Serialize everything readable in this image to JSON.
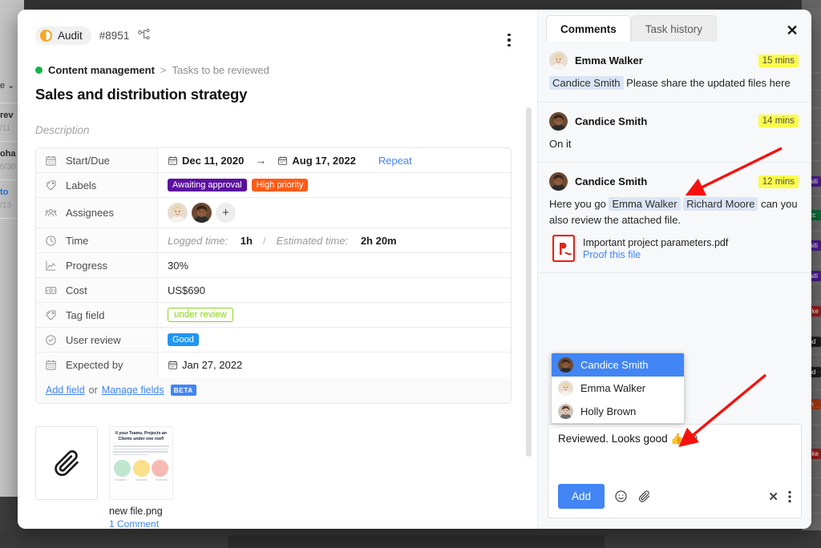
{
  "background": {
    "left_items": [
      {
        "title": "rev",
        "sub": "/11"
      },
      {
        "title": "oha",
        "sub": "6/30"
      },
      {
        "title": "to",
        "sub": "/13"
      }
    ],
    "left_dropdown": "e",
    "right_chips": [
      {
        "label": "waiti",
        "color": "#4a1a8f"
      },
      {
        "label": "Acc",
        "color": "#0b6b35"
      },
      {
        "label": "waiti",
        "color": "#4a1a8f"
      },
      {
        "label": "waiti",
        "color": "#4a1a8f"
      },
      {
        "label": "ocke",
        "color": "#9b1c1c"
      },
      {
        "label": "and",
        "color": "#1c1c1c"
      },
      {
        "label": "and",
        "color": "#1c1c1c"
      },
      {
        "label": "igh",
        "color": "#a63a10"
      },
      {
        "label": "ocke",
        "color": "#9b1c1c"
      }
    ]
  },
  "header": {
    "status_label": "Audit",
    "task_id": "#8951",
    "hierarchy_icon": "subtask-tree-icon",
    "more_icon": "kebab-menu-icon"
  },
  "breadcrumb": {
    "project": "Content management",
    "separator": ">",
    "list": "Tasks to be reviewed"
  },
  "title": "Sales and distribution strategy",
  "description_placeholder": "Description",
  "details": {
    "rows": [
      {
        "icon": "calendar-icon",
        "label": "Start/Due",
        "type": "dates",
        "start": "Dec 11, 2020",
        "arrow": "→",
        "due": "Aug 17, 2022",
        "action": "Repeat"
      },
      {
        "icon": "tag-icon",
        "label": "Labels",
        "type": "chips",
        "chips": [
          {
            "text": "Awaiting approval",
            "bg": "#5b0f9e",
            "fg": "#ffffff"
          },
          {
            "text": "High priority",
            "bg": "#ff5b18",
            "fg": "#ffffff"
          }
        ]
      },
      {
        "icon": "people-icon",
        "label": "Assignees",
        "type": "avatars",
        "add_label": "+"
      },
      {
        "icon": "clock-icon",
        "label": "Time",
        "type": "time",
        "logged_label": "Logged time:",
        "logged_value": "1h",
        "estimated_label": "Estimated time:",
        "estimated_value": "2h 20m"
      },
      {
        "icon": "chart-icon",
        "label": "Progress",
        "type": "text",
        "value": "30%"
      },
      {
        "icon": "money-icon",
        "label": "Cost",
        "type": "text",
        "value": "US$690"
      },
      {
        "icon": "tag-icon",
        "label": "Tag field",
        "type": "outline-chip",
        "chip": {
          "text": "under review",
          "border": "#8bd41b",
          "fg": "#8bd41b"
        }
      },
      {
        "icon": "check-circle-icon",
        "label": "User review",
        "type": "chips",
        "chips": [
          {
            "text": "Good",
            "bg": "#2196f3",
            "fg": "#ffffff"
          }
        ]
      },
      {
        "icon": "calendar-icon",
        "label": "Expected by",
        "type": "date",
        "value": "Jan 27, 2022"
      }
    ],
    "footer": {
      "add_field": "Add field",
      "or": "or",
      "manage_fields": "Manage fields",
      "beta": "BETA"
    }
  },
  "attachments": {
    "clip_icon": "paperclip-icon",
    "thumbnail_heading": "ll your Teams, Projects an Clients under one roof!",
    "file_name": "new file.png",
    "comment_link": "1 Comment"
  },
  "right_panel": {
    "tabs": [
      {
        "label": "Comments",
        "active": true
      },
      {
        "label": "Task history",
        "active": false
      }
    ],
    "close_icon": "close-icon",
    "comments": [
      {
        "author": "Emma Walker",
        "time": "15 mins",
        "mentions": [
          "Candice Smith"
        ],
        "text": "Please share the updated files here"
      },
      {
        "author": "Candice Smith",
        "time": "14 mins",
        "mentions": [],
        "text": "On it"
      },
      {
        "author": "Candice Smith",
        "time": "12 mins",
        "text_before": "Here you go",
        "mentions": [
          "Emma Walker",
          "Richard Moore"
        ],
        "text_after": "can you also review the attached file.",
        "attachment": {
          "icon": "pdf-file-icon",
          "name": "Important project parameters.pdf",
          "action": "Proof this file"
        }
      }
    ],
    "mention_menu": {
      "items": [
        {
          "name": "Candice Smith",
          "selected": true
        },
        {
          "name": "Emma Walker",
          "selected": false
        },
        {
          "name": "Holly Brown",
          "selected": false
        }
      ]
    },
    "composer": {
      "text": "Reviewed. Looks good 👍 @",
      "add_label": "Add",
      "emoji_icon": "emoji-icon",
      "attach_icon": "paperclip-icon",
      "clear_icon": "close-icon",
      "more_icon": "kebab-menu-icon"
    }
  },
  "annotations": {
    "arrow_color": "#f5120e",
    "arrow_count": 2
  }
}
